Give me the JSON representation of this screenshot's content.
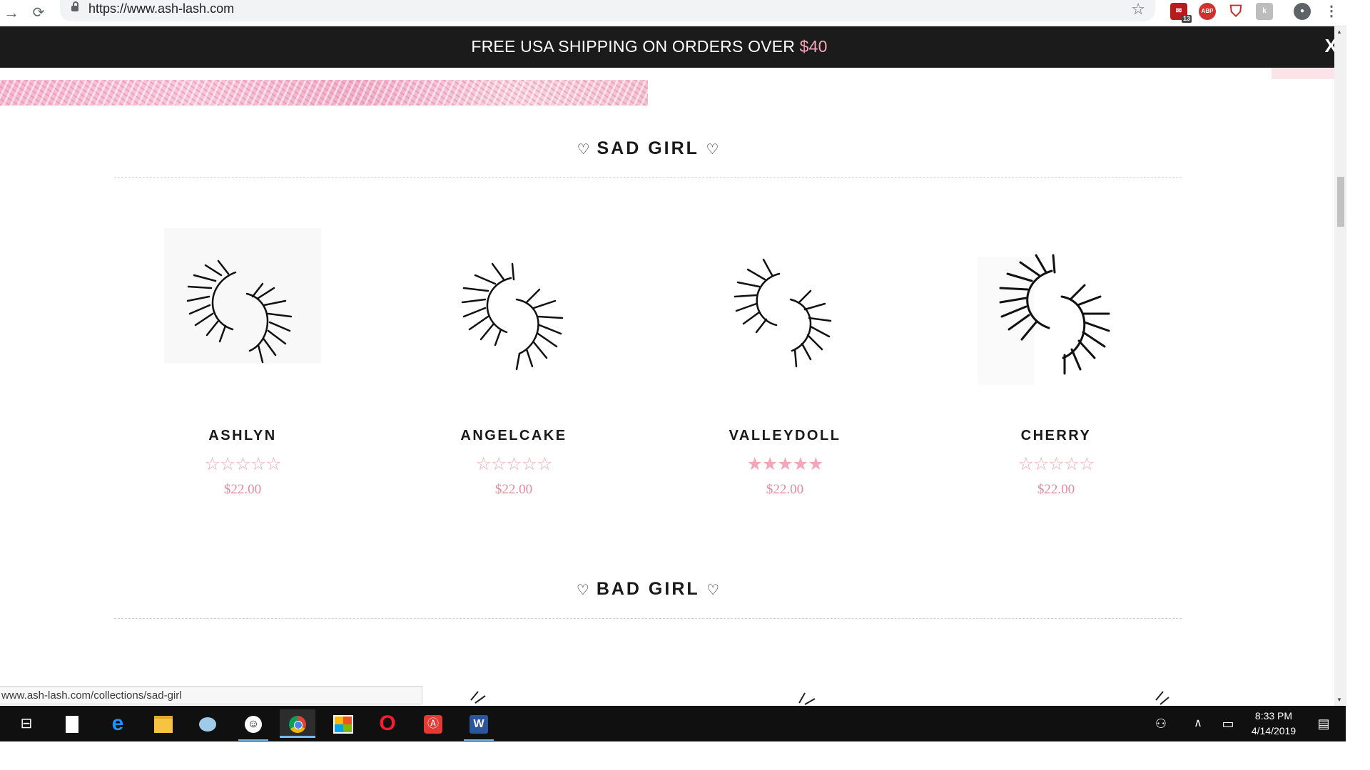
{
  "browser": {
    "url": "https://www.ash-lash.com",
    "extension_badge": "13",
    "abp_label": "ABP"
  },
  "announcement": {
    "text": "FREE USA SHIPPING ON ORDERS OVER ",
    "amount": "$40",
    "close_label": "X"
  },
  "sections": [
    {
      "title": "SAD GIRL",
      "products": [
        {
          "name": "ASHLYN",
          "rating": 0,
          "stars": "☆☆☆☆☆",
          "price": "$22.00"
        },
        {
          "name": "ANGELCAKE",
          "rating": 0,
          "stars": "☆☆☆☆☆",
          "price": "$22.00"
        },
        {
          "name": "VALLEYDOLL",
          "rating": 5,
          "stars": "★★★★★",
          "price": "$22.00"
        },
        {
          "name": "CHERRY",
          "rating": 0,
          "stars": "☆☆☆☆☆",
          "price": "$22.00"
        }
      ]
    },
    {
      "title": "BAD GIRL"
    }
  ],
  "status_url": "www.ash-lash.com/collections/sad-girl",
  "taskbar": {
    "time": "8:33 PM",
    "date": "4/14/2019"
  },
  "colors": {
    "announcement_bg": "#1b1b1b",
    "accent_pink": "#f4a6b7",
    "price_pink": "#e58a9d"
  },
  "icons": {
    "heart": "♡",
    "star": "☆"
  }
}
